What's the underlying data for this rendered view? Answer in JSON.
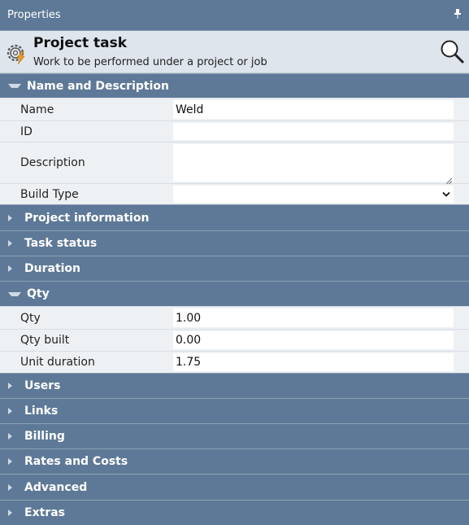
{
  "panel": {
    "title": "Properties"
  },
  "header": {
    "title": "Project task",
    "subtitle": "Work to be performed under a project or job"
  },
  "sections": {
    "name_desc": "Name and Description",
    "project_info": "Project information",
    "task_status": "Task status",
    "duration": "Duration",
    "qty": "Qty",
    "users": "Users",
    "links": "Links",
    "billing": "Billing",
    "rates": "Rates and Costs",
    "advanced": "Advanced",
    "extras": "Extras"
  },
  "fields": {
    "name": {
      "label": "Name",
      "value": "Weld"
    },
    "id": {
      "label": "ID",
      "value": ""
    },
    "description": {
      "label": "Description",
      "value": ""
    },
    "build_type": {
      "label": "Build Type",
      "value": ""
    },
    "qty": {
      "label": "Qty",
      "value": "1.00"
    },
    "qty_built": {
      "label": "Qty built",
      "value": "0.00"
    },
    "unit_duration": {
      "label": "Unit duration",
      "value": "1.75"
    }
  },
  "icons": {
    "pin": "pin-icon",
    "task": "gear-lightning-icon",
    "search": "search-icon",
    "expand": "triangle-right-icon",
    "collapse": "triangle-down-icon",
    "dropdown": "chevron-down-icon"
  }
}
